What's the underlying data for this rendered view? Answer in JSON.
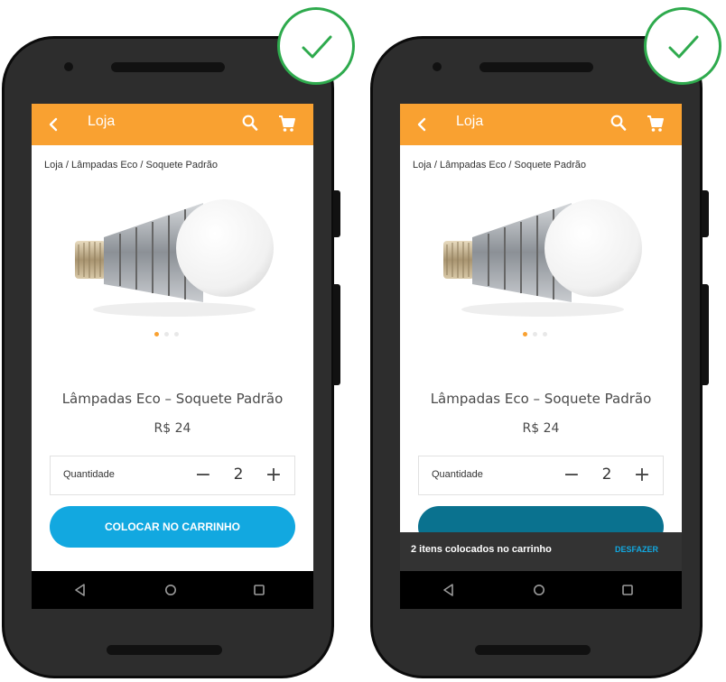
{
  "colors": {
    "app_bar": "#f9a131",
    "cta": "#12a8e0",
    "cta_pressed": "#0a728f",
    "snackbar_bg": "#333333",
    "snackbar_action": "#12a8e0",
    "check": "#2eaa4d"
  },
  "icons": {
    "back": "chevron-left-icon",
    "search": "search-icon",
    "cart": "cart-icon",
    "check": "check-icon",
    "nav_back": "triangle-back-icon",
    "nav_home": "circle-home-icon",
    "nav_recents": "square-recents-icon"
  },
  "left_screen": {
    "app_bar": {
      "title": "Loja"
    },
    "breadcrumb": "Loja / Lâmpadas Eco / Soquete Padrão",
    "carousel": {
      "slides": 3,
      "active_index": 0
    },
    "product": {
      "name": "Lâmpadas Eco – Soquete Padrão",
      "price": "R$ 24"
    },
    "quantity": {
      "label": "Quantidade",
      "minus": "−",
      "value": "2",
      "plus": "+"
    },
    "cta_label": "COLOCAR NO CARRINHO"
  },
  "right_screen": {
    "app_bar": {
      "title": "Loja"
    },
    "breadcrumb": "Loja / Lâmpadas Eco / Soquete Padrão",
    "carousel": {
      "slides": 3,
      "active_index": 0
    },
    "product": {
      "name": "Lâmpadas Eco – Soquete Padrão",
      "price": "R$ 24"
    },
    "quantity": {
      "label": "Quantidade",
      "minus": "−",
      "value": "2",
      "plus": "+"
    },
    "snackbar": {
      "message": "2 itens colocados no carrinho",
      "action": "DESFAZER"
    }
  }
}
